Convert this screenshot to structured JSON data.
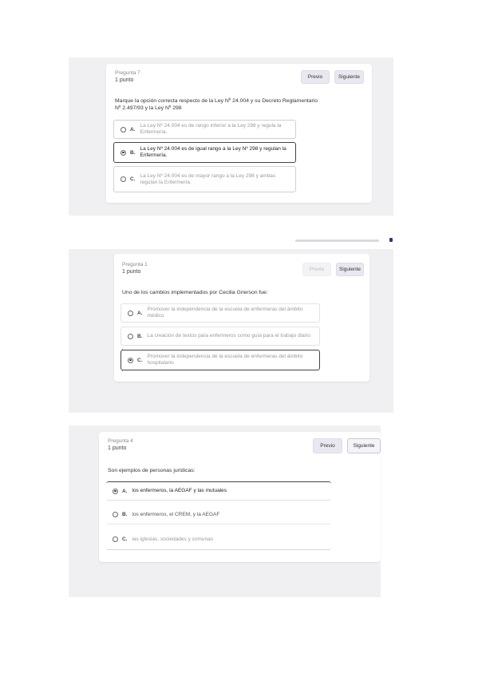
{
  "q7": {
    "number": "Pregunta 7",
    "points": "1 punto",
    "prev": "Previo",
    "next": "Siguiente",
    "text": "Marque la opción correcta respecto de la Ley Nº 24.004 y su Decreto Reglamentario Nº 2.497/93 y la Ley Nº 298",
    "options": [
      {
        "letter": "A.",
        "text": "La Ley Nº 24.004 es de rango inferior a la Ley 298 y regula la Enfermería.",
        "selected": false
      },
      {
        "letter": "B.",
        "text": "La Ley Nº 24.004 es de igual rango a la Ley Nº 298 y regulan la Enfermería.",
        "selected": true
      },
      {
        "letter": "C.",
        "text": "La Ley Nº 24.004 es de mayor rango a la Ley 298 y ambas regulan la Enfermería.",
        "selected": false
      }
    ]
  },
  "q1": {
    "number": "Pregunta 1",
    "points": "1 punto",
    "prev": "Previo",
    "next": "Siguiente",
    "text": "Uno de los cambios implementados por Cecilia Grierson fue:",
    "options": [
      {
        "letter": "A.",
        "text": "Promover la independencia de la escuela de enfermeras del ámbito médico",
        "selected": false
      },
      {
        "letter": "B.",
        "text": "La creación de textos para enfermeros como guía para el trabajo diario",
        "selected": false
      },
      {
        "letter": "C.",
        "text": "Promover la independencia de la escuela de enfermeras del ámbito hospitalario",
        "selected": true
      }
    ]
  },
  "q4": {
    "number": "Pregunta 4",
    "points": "1 punto",
    "prev": "Previo",
    "next": "Siguiente",
    "text": "Son ejemplos de personas jurídicas:",
    "options": [
      {
        "letter": "A.",
        "text": "los enfermeros, la AEGAF y las mutuales",
        "selected": true
      },
      {
        "letter": "B.",
        "text": "los enfermeros, el CREM, y la AEGAF",
        "selected": false
      },
      {
        "letter": "C.",
        "text": "las iglesias, sociedades y comunas",
        "selected": false
      }
    ]
  }
}
